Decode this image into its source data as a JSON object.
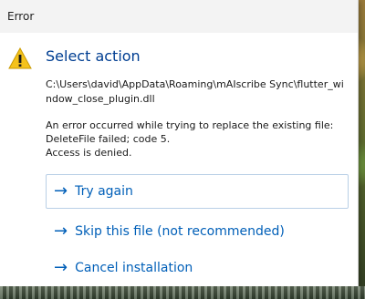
{
  "window": {
    "title": "Error"
  },
  "dialog": {
    "heading": "Select action",
    "path": "C:\\Users\\david\\AppData\\Roaming\\mAIscribe Sync\\flutter_window_close_plugin.dll",
    "message_lines": [
      "An error occurred while trying to replace the existing file:",
      "DeleteFile failed; code 5.",
      "Access is denied."
    ],
    "icon": "warning-icon",
    "accent_color": "#005fb8"
  },
  "actions": [
    {
      "label": "Try again",
      "icon": "right-arrow-icon",
      "focused": true
    },
    {
      "label": "Skip this file (not recommended)",
      "icon": "right-arrow-icon",
      "focused": false
    },
    {
      "label": "Cancel installation",
      "icon": "right-arrow-icon",
      "focused": false
    }
  ]
}
